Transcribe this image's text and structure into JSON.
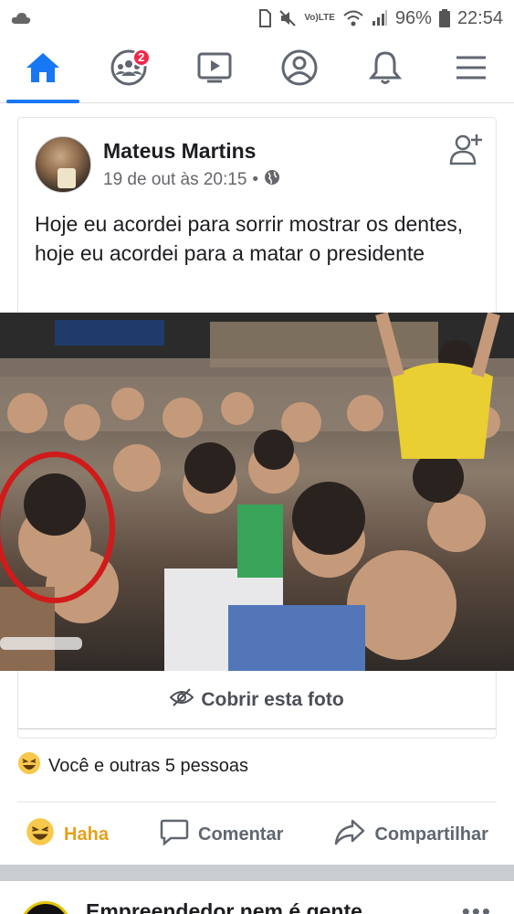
{
  "status_bar": {
    "time": "22:54",
    "battery": "96%",
    "network": "LTE"
  },
  "nav": {
    "items": [
      {
        "name": "home",
        "icon": "home-icon"
      },
      {
        "name": "groups",
        "icon": "groups-icon",
        "badge": "2"
      },
      {
        "name": "watch",
        "icon": "video-icon"
      },
      {
        "name": "profile",
        "icon": "profile-icon"
      },
      {
        "name": "notifications",
        "icon": "bell-icon"
      },
      {
        "name": "menu",
        "icon": "hamburger-menu-icon"
      }
    ]
  },
  "post": {
    "author": "Mateus Martins",
    "timestamp": "19 de out às 20:15",
    "separator": "•",
    "text": "Hoje eu acordei para sorrir mostrar os dentes, hoje eu acordei para a matar o presidente",
    "cover_photo_label": "Cobrir esta foto",
    "reactions_text": "Você e outras 5 pessoas",
    "actions": {
      "haha": "Haha",
      "comment": "Comentar",
      "share": "Compartilhar"
    }
  },
  "next_post": {
    "author": "Empreendedor nem é gente"
  },
  "colors": {
    "brand_blue": "#1877f2",
    "haha_yellow": "#e4a11b",
    "badge_red": "#f02849"
  }
}
